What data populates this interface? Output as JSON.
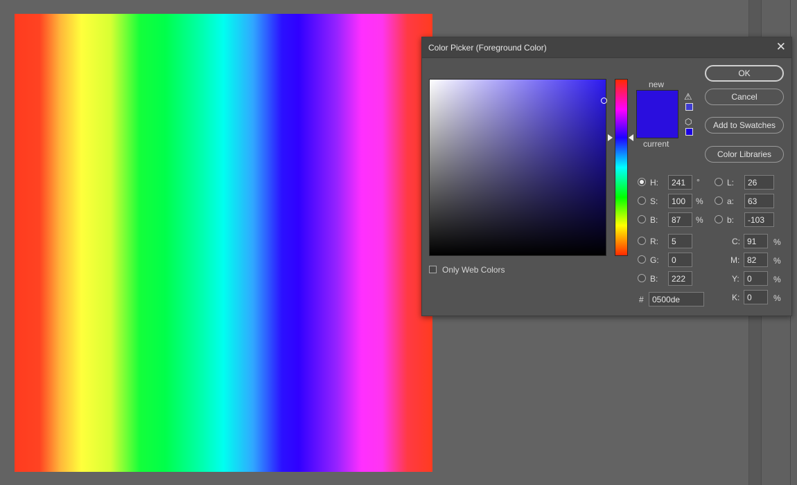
{
  "dialog": {
    "title": "Color Picker (Foreground Color)",
    "close_glyph": "✕"
  },
  "preview": {
    "new_label": "new",
    "current_label": "current",
    "new_color": "#2a0ede",
    "current_color": "#2a0ede"
  },
  "buttons": {
    "ok": "OK",
    "cancel": "Cancel",
    "add_to_swatches": "Add to Swatches",
    "color_libraries": "Color Libraries"
  },
  "only_web_colors": {
    "label": "Only Web Colors",
    "checked": false
  },
  "hsb": {
    "h": {
      "label": "H:",
      "value": "241",
      "unit": "°",
      "selected": true
    },
    "s": {
      "label": "S:",
      "value": "100",
      "unit": "%"
    },
    "b": {
      "label": "B:",
      "value": "87",
      "unit": "%"
    }
  },
  "rgb": {
    "r": {
      "label": "R:",
      "value": "5"
    },
    "g": {
      "label": "G:",
      "value": "0"
    },
    "b": {
      "label": "B:",
      "value": "222"
    }
  },
  "lab": {
    "l": {
      "label": "L:",
      "value": "26"
    },
    "a": {
      "label": "a:",
      "value": "63"
    },
    "b": {
      "label": "b:",
      "value": "-103"
    }
  },
  "cmyk": {
    "c": {
      "label": "C:",
      "value": "91",
      "unit": "%"
    },
    "m": {
      "label": "M:",
      "value": "82",
      "unit": "%"
    },
    "y": {
      "label": "Y:",
      "value": "0",
      "unit": "%"
    },
    "k": {
      "label": "K:",
      "value": "0",
      "unit": "%"
    }
  },
  "hex": {
    "label": "#",
    "value": "0500de"
  },
  "icons": {
    "gamut_warning": "warning-triangle-icon",
    "web_safe": "cube-icon"
  }
}
